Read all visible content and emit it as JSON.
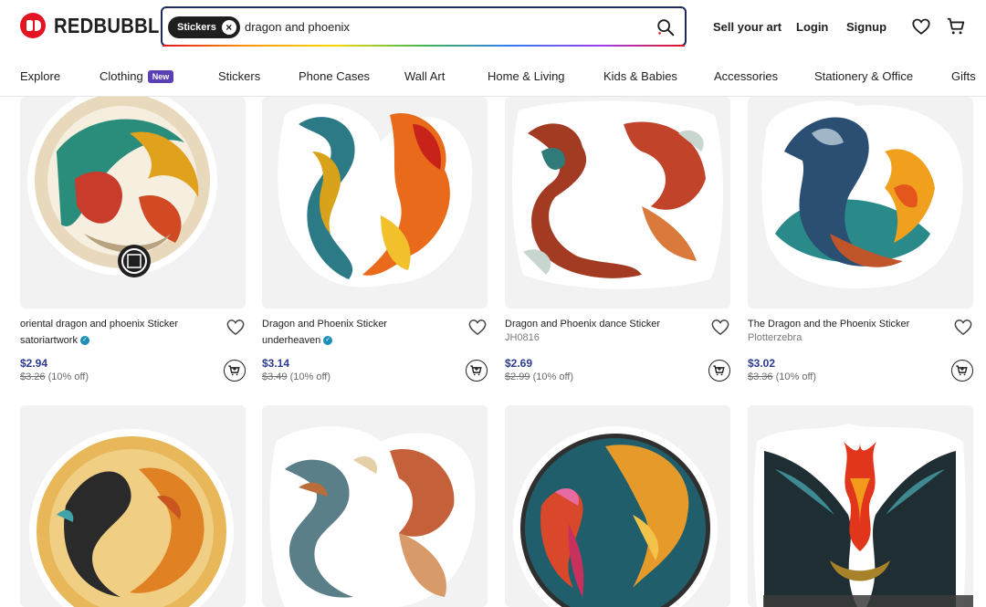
{
  "header": {
    "logo_text": "REDBUBBLE",
    "search": {
      "category_chip": "Stickers",
      "query": "dragon and phoenix"
    },
    "links": {
      "sell": "Sell your art",
      "login": "Login",
      "signup": "Signup"
    }
  },
  "nav": {
    "items": [
      "Explore",
      "Clothing",
      "Stickers",
      "Phone Cases",
      "Wall Art",
      "Home & Living",
      "Kids & Babies",
      "Accessories",
      "Stationery & Office",
      "Gifts"
    ],
    "new_badge": "New"
  },
  "products": [
    {
      "title": "oriental dragon and phoenix Sticker",
      "artist": "satoriartwork",
      "verified": true,
      "price": "$2.94",
      "original_price": "$3.26",
      "discount": "(10% off)"
    },
    {
      "title": "Dragon and Phoenix Sticker",
      "artist": "underheaven",
      "verified": true,
      "price": "$3.14",
      "original_price": "$3.49",
      "discount": "(10% off)"
    },
    {
      "title": "Dragon and Phoenix dance Sticker",
      "artist": "JH0816",
      "verified": false,
      "price": "$2.69",
      "original_price": "$2.99",
      "discount": "(10% off)"
    },
    {
      "title": "The Dragon and the Phoenix Sticker",
      "artist": "Plotterzebra",
      "verified": false,
      "price": "$3.02",
      "original_price": "$3.36",
      "discount": "(10% off)"
    },
    {
      "title": "",
      "artist": "",
      "verified": false,
      "price": "",
      "original_price": "",
      "discount": ""
    },
    {
      "title": "",
      "artist": "",
      "verified": false,
      "price": "",
      "original_price": "",
      "discount": ""
    },
    {
      "title": "",
      "artist": "",
      "verified": false,
      "price": "",
      "original_price": "",
      "discount": ""
    },
    {
      "title": "",
      "artist": "",
      "verified": false,
      "price": "",
      "original_price": "",
      "discount": ""
    }
  ],
  "colors": {
    "brand_red": "#e41321",
    "price_blue": "#2b3a8f",
    "search_border": "#1f2a5c",
    "new_badge": "#5b3fb5"
  }
}
